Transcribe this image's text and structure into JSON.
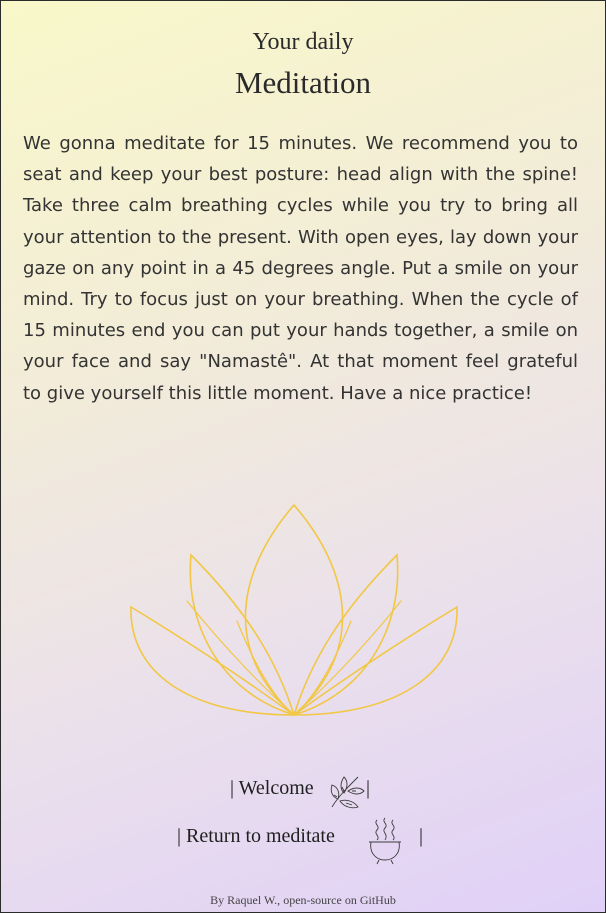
{
  "header": {
    "subtitle": "Your daily",
    "title": "Meditation"
  },
  "intro": {
    "text": "We gonna meditate for 15 minutes. We recommend you to seat and keep your best posture: head align with the spine! Take three calm breathing cycles while you try to bring all your attention to the present. With open eyes, lay down your gaze on any point in a 45 degrees angle. Put a smile on your mind. Try to focus just on your breathing. When the cycle of 15 minutes end you can put your hands together, a smile on your face and say \"Namastê\". At that moment feel grateful to give yourself this little moment. Have a nice practice!"
  },
  "illustration": {
    "icon": "lotus-icon",
    "color": "#f2c744"
  },
  "nav": {
    "welcome_label": "| Welcome",
    "welcome_icon": "leaves-icon",
    "return_label": "| Return to meditate",
    "return_icon": "incense-pot-icon",
    "separator": "|"
  },
  "footer": {
    "prefix": "By Raquel W., ",
    "link_label": "open-source on GitHub"
  }
}
